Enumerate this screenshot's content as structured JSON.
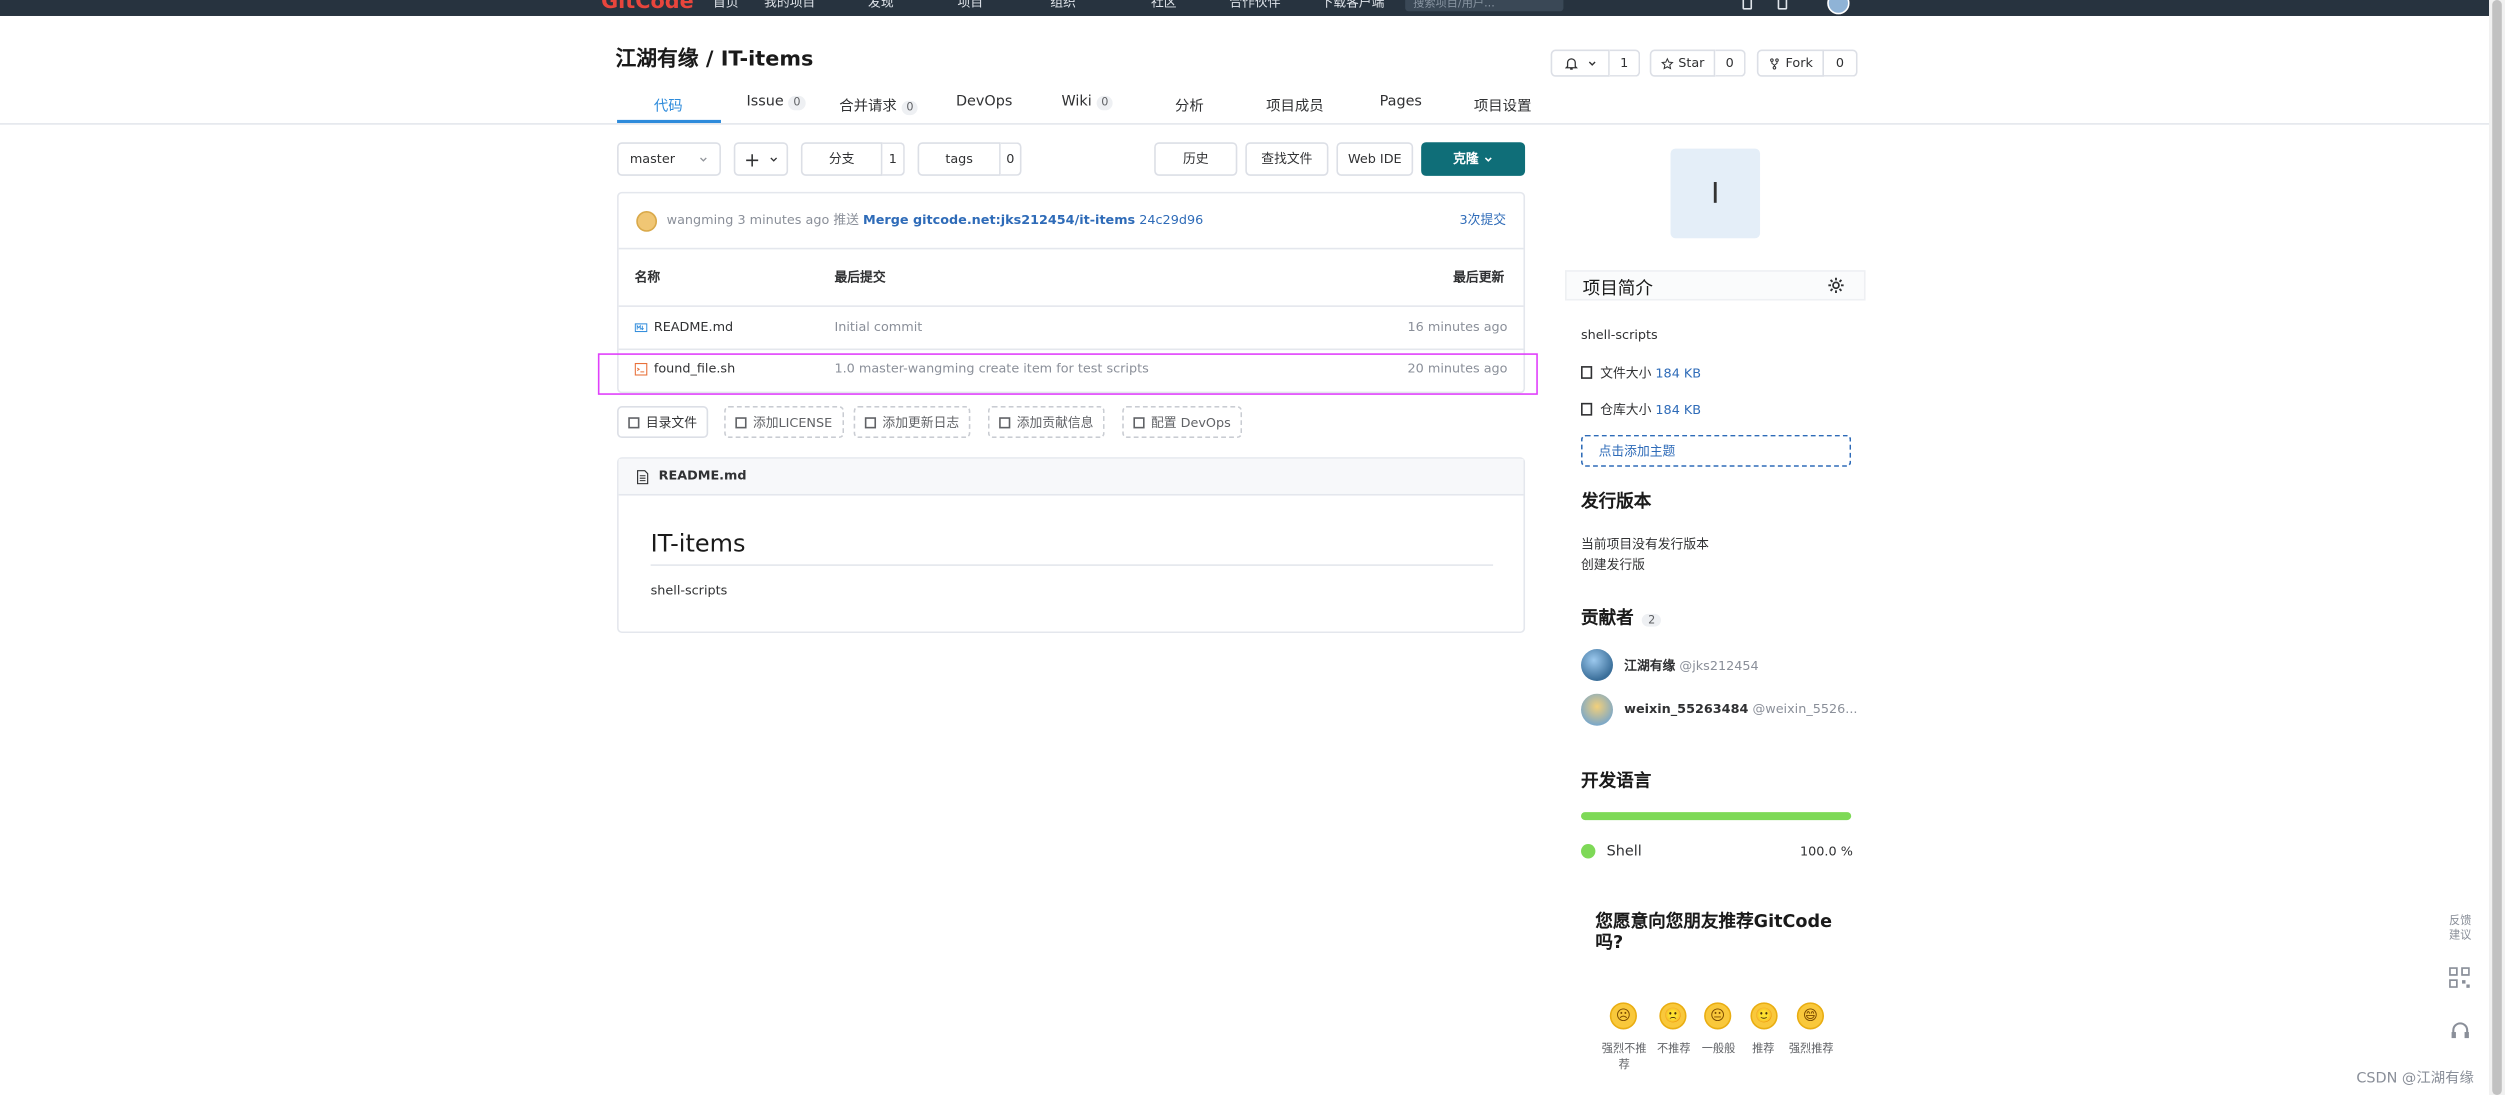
{
  "topbar": {
    "logo": "GitCode",
    "nav": [
      "首页",
      "我的项目",
      "发现",
      "项目",
      "组织",
      "社区",
      "合作伙伴",
      "下载客户端"
    ],
    "search_placeholder": "搜索项目/用户..."
  },
  "repo": {
    "owner": "江湖有缘",
    "sep": "/",
    "name": "IT-items",
    "watch_count": "1",
    "star_label": "Star",
    "star_count": "0",
    "fork_label": "Fork",
    "fork_count": "0"
  },
  "tabs": [
    {
      "label": "代码",
      "badge": ""
    },
    {
      "label": "Issue",
      "badge": "0"
    },
    {
      "label": "合并请求",
      "badge": "0"
    },
    {
      "label": "DevOps",
      "badge": ""
    },
    {
      "label": "Wiki",
      "badge": "0"
    },
    {
      "label": "分析",
      "badge": ""
    },
    {
      "label": "项目成员",
      "badge": ""
    },
    {
      "label": "Pages",
      "badge": ""
    },
    {
      "label": "项目设置",
      "badge": ""
    }
  ],
  "toolbar": {
    "branch": "master",
    "plus": "+",
    "branches_label": "分支",
    "branches_count": "1",
    "tags_label": "tags",
    "tags_count": "0",
    "history": "历史",
    "find_file": "查找文件",
    "web_ide": "Web IDE",
    "clone": "克隆"
  },
  "last_commit": {
    "author": "wangming",
    "time": "3 minutes ago",
    "action": "推送",
    "message": "Merge gitcode.net:jks212454/it-items",
    "hash": "24c29d96",
    "commits_link": "3次提交"
  },
  "file_table": {
    "headers": [
      "名称",
      "最后提交",
      "最后更新"
    ],
    "rows": [
      {
        "name": "README.md",
        "commit": "Initial commit",
        "updated": "16 minutes ago"
      },
      {
        "name": "found_file.sh",
        "commit": "1.0 master-wangming create item for test scripts",
        "updated": "20 minutes ago"
      }
    ]
  },
  "quick_actions": [
    "目录文件",
    "添加LICENSE",
    "添加更新日志",
    "添加贡献信息",
    "配置 DevOps"
  ],
  "readme": {
    "file": "README.md",
    "heading": "IT-items",
    "body": "shell-scripts"
  },
  "sidebar": {
    "avatar_letter": "I",
    "intro_title": "项目简介",
    "description": "shell-scripts",
    "file_size_label": "文件大小",
    "file_size": "184 KB",
    "repo_size_label": "仓库大小",
    "repo_size": "184 KB",
    "add_topic": "点击添加主题",
    "releases_title": "发行版本",
    "releases_empty": "当前项目没有发行版本",
    "create_release": "创建发行版",
    "contributors_title": "贡献者",
    "contributors_count": "2",
    "contributors": [
      {
        "name": "江湖有缘",
        "handle": "@jks212454"
      },
      {
        "name": "weixin_55263484",
        "handle": "@weixin_5526..."
      }
    ],
    "languages_title": "开发语言",
    "languages": [
      {
        "name": "Shell",
        "percent": "100.0 %",
        "share": 1.0
      }
    ],
    "recommend_q": "您愿意向您朋友推荐GitCode吗?",
    "ratings": [
      "强烈不推荐",
      "不推荐",
      "一般般",
      "推荐",
      "强烈推荐"
    ]
  },
  "float": {
    "feedback": "反馈建议"
  },
  "watermark": "CSDN @江湖有缘",
  "colors": {
    "accent": "#2e8bdb",
    "clone": "#0f6e78",
    "highlight": "#e040fb",
    "shell": "#7ed957"
  }
}
